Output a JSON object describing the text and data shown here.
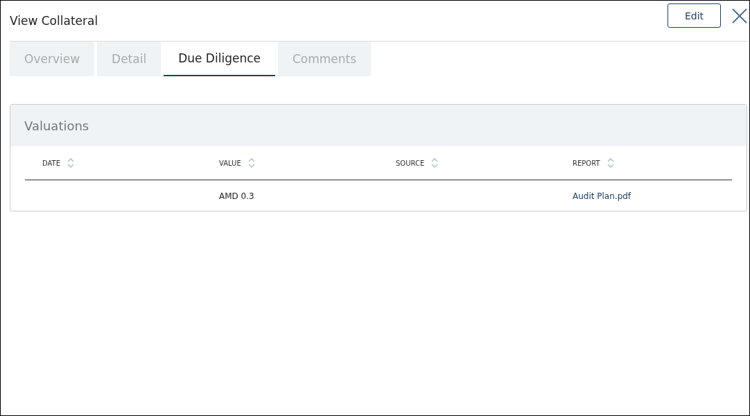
{
  "window": {
    "title": "View Collateral",
    "edit_button": "Edit"
  },
  "tabs": [
    {
      "label": "Overview",
      "selected": false
    },
    {
      "label": "Detail",
      "selected": false
    },
    {
      "label": "Due Diligence",
      "selected": true
    },
    {
      "label": "Comments",
      "selected": false
    }
  ],
  "valuations": {
    "title": "Valuations",
    "columns": [
      "DATE",
      "VALUE",
      "SOURCE",
      "REPORT"
    ],
    "rows": [
      {
        "value": "AMD 0.3",
        "report": "Audit Plan.pdf"
      }
    ]
  }
}
